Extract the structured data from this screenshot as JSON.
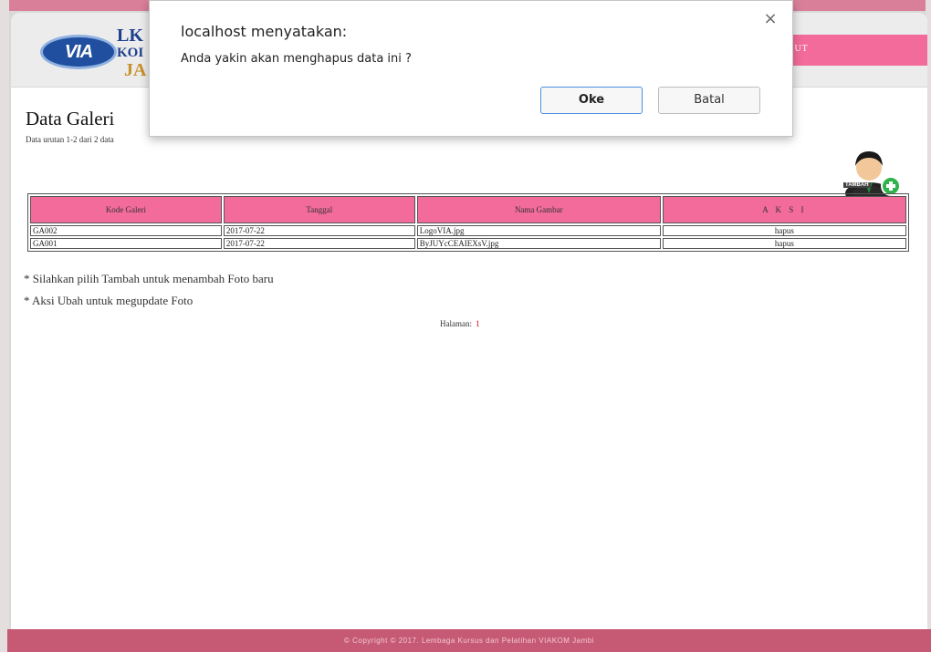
{
  "header": {
    "logo_text": "VIA",
    "brand_line1": "LK",
    "brand_line2": "KOI",
    "brand_line3": "JA",
    "nav_logout_fragment": "GOUT"
  },
  "main": {
    "title": "Data Galeri",
    "subtitle": "Data urutan 1-2 dari 2 data",
    "add_label": "TAMBAH",
    "table": {
      "headers": [
        "Kode Galeri",
        "Tanggal",
        "Nama Gambar",
        "A K S I"
      ],
      "rows": [
        [
          "GA002",
          "2017-07-22",
          "LogoVIA.jpg",
          "hapus"
        ],
        [
          "GA001",
          "2017-07-22",
          "ByJUYcCEAIEXsV.jpg",
          "hapus"
        ]
      ]
    },
    "notes": [
      "* Silahkan pilih Tambah untuk menambah Foto baru",
      "* Aksi Ubah untuk megupdate Foto"
    ],
    "pagination": {
      "label": "Halaman:",
      "current": "1"
    }
  },
  "footer": {
    "copyright": "© Copyright © 2017. Lembaga Kursus dan Pelatihan VIAKOM Jambi"
  },
  "dialog": {
    "title": "localhost menyatakan:",
    "message": "Anda yakin akan menghapus data ini ?",
    "ok_label": "Oke",
    "cancel_label": "Batal",
    "close_glyph": "×"
  },
  "colors": {
    "accent_pink": "#f26b9a",
    "footer_pink": "#c65a74",
    "brand_blue": "#1f4f9e",
    "ok_focus_blue": "#4d8fe0"
  }
}
